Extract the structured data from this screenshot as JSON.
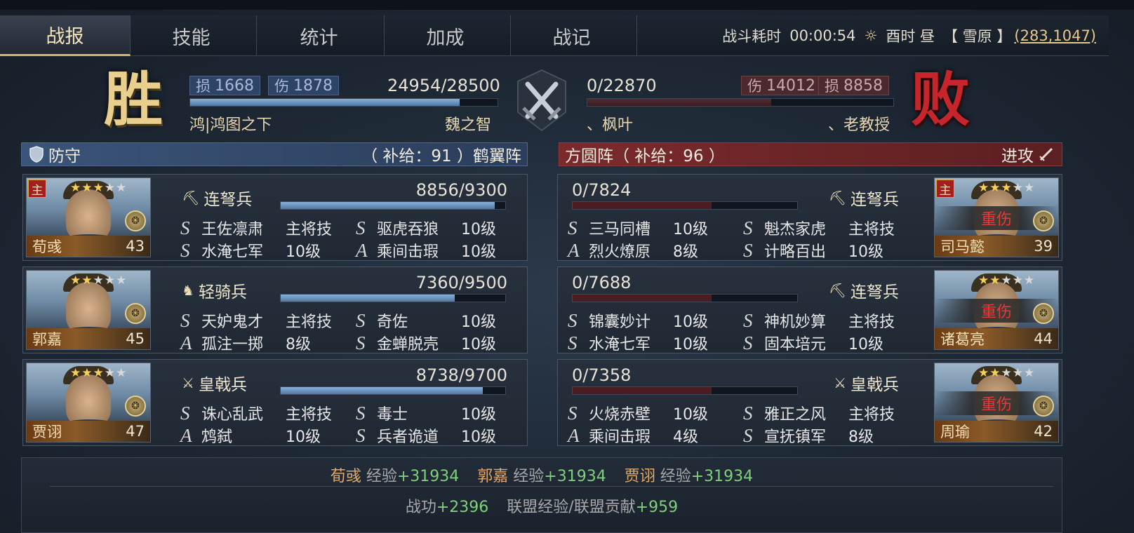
{
  "tabs": [
    "战报",
    "技能",
    "统计",
    "加成",
    "战记"
  ],
  "battle": {
    "duration_label": "战斗耗时",
    "duration": "00:00:54",
    "weather_icon": "sun-icon",
    "time_label": "酉时 昼",
    "terrain": "【 雪原 】",
    "coords": "(283,1047)"
  },
  "left": {
    "result": "胜",
    "loss_label": "损",
    "loss": "1668",
    "dmg_label": "伤",
    "dmg": "1878",
    "troops": "24954/28500",
    "troop_ratio": 0.876,
    "alliance": "鸿|鸿图之下",
    "player": "魏之智",
    "stance_icon": "shield-icon",
    "stance": "防守",
    "formation": "（ 补给：91 ）鹤翼阵"
  },
  "right": {
    "result": "败",
    "dmg_label": "伤",
    "dmg": "14012",
    "loss_label": "损",
    "loss": "8858",
    "troops": "0/22870",
    "troop_ratio": 0.0,
    "alliance": "、枫叶",
    "player": "、老教授",
    "stance": "进攻",
    "stance_icon": "sword-icon",
    "formation": "方圆阵（ 补给：96 ）"
  },
  "left_generals": [
    {
      "name": "荀彧",
      "level": "43",
      "main": "主",
      "stars": 3,
      "unit_icon": "crossbow-icon",
      "unit": "连弩兵",
      "troops": "8856/9300",
      "ratio": 0.952,
      "skills": [
        {
          "g": "S",
          "n": "王佐凛肃",
          "l": "主将技"
        },
        {
          "g": "S",
          "n": "驱虎吞狼",
          "l": "10级"
        },
        {
          "g": "S",
          "n": "水淹七军",
          "l": "10级"
        },
        {
          "g": "A",
          "n": "乘间击瑕",
          "l": "10级"
        }
      ]
    },
    {
      "name": "郭嘉",
      "level": "45",
      "main": "",
      "stars": 2,
      "unit_icon": "horse-icon",
      "unit": "轻骑兵",
      "troops": "7360/9500",
      "ratio": 0.775,
      "skills": [
        {
          "g": "S",
          "n": "天妒鬼才",
          "l": "主将技"
        },
        {
          "g": "S",
          "n": "奇佐",
          "l": "10级"
        },
        {
          "g": "A",
          "n": "孤注一掷",
          "l": "8级"
        },
        {
          "g": "S",
          "n": "金蝉脱壳",
          "l": "10级"
        }
      ]
    },
    {
      "name": "贾诩",
      "level": "47",
      "main": "",
      "stars": 3,
      "unit_icon": "halberd-icon",
      "unit": "皇戟兵",
      "troops": "8738/9700",
      "ratio": 0.901,
      "skills": [
        {
          "g": "S",
          "n": "诛心乱武",
          "l": "主将技"
        },
        {
          "g": "S",
          "n": "毒士",
          "l": "10级"
        },
        {
          "g": "A",
          "n": "鸩弑",
          "l": "10级"
        },
        {
          "g": "S",
          "n": "兵者诡道",
          "l": "10级"
        }
      ]
    }
  ],
  "right_generals": [
    {
      "name": "司马懿",
      "level": "39",
      "main": "主",
      "stars": 3,
      "status": "重伤",
      "unit_icon": "crossbow-icon",
      "unit": "连弩兵",
      "troops": "0/7824",
      "ratio": 0.0,
      "skills": [
        {
          "g": "S",
          "n": "三马同槽",
          "l": "10级"
        },
        {
          "g": "S",
          "n": "魁杰家虎",
          "l": "主将技"
        },
        {
          "g": "A",
          "n": "烈火燎原",
          "l": "8级"
        },
        {
          "g": "S",
          "n": "计略百出",
          "l": "10级"
        }
      ]
    },
    {
      "name": "诸葛亮",
      "level": "44",
      "main": "",
      "stars": 2,
      "status": "重伤",
      "unit_icon": "crossbow-icon",
      "unit": "连弩兵",
      "troops": "0/7688",
      "ratio": 0.0,
      "skills": [
        {
          "g": "S",
          "n": "锦囊妙计",
          "l": "10级"
        },
        {
          "g": "S",
          "n": "神机妙算",
          "l": "主将技"
        },
        {
          "g": "S",
          "n": "水淹七军",
          "l": "10级"
        },
        {
          "g": "S",
          "n": "固本培元",
          "l": "10级"
        }
      ]
    },
    {
      "name": "周瑜",
      "level": "42",
      "main": "",
      "stars": 2,
      "status": "重伤",
      "unit_icon": "halberd-icon",
      "unit": "皇戟兵",
      "troops": "0/7358",
      "ratio": 0.0,
      "skills": [
        {
          "g": "S",
          "n": "火烧赤壁",
          "l": "10级"
        },
        {
          "g": "S",
          "n": "雅正之风",
          "l": "主将技"
        },
        {
          "g": "A",
          "n": "乘间击瑕",
          "l": "4级"
        },
        {
          "g": "S",
          "n": "宣抚镇军",
          "l": "8级"
        }
      ]
    }
  ],
  "rewards": {
    "exp_label": "经验",
    "exp": [
      {
        "name": "荀彧",
        "value": "+31934"
      },
      {
        "name": "郭嘉",
        "value": "+31934"
      },
      {
        "name": "贾诩",
        "value": "+31934"
      }
    ],
    "merit_label": "战功",
    "merit": "+2396",
    "alliance_label": "联盟经验/联盟贡献",
    "alliance": "+959"
  }
}
